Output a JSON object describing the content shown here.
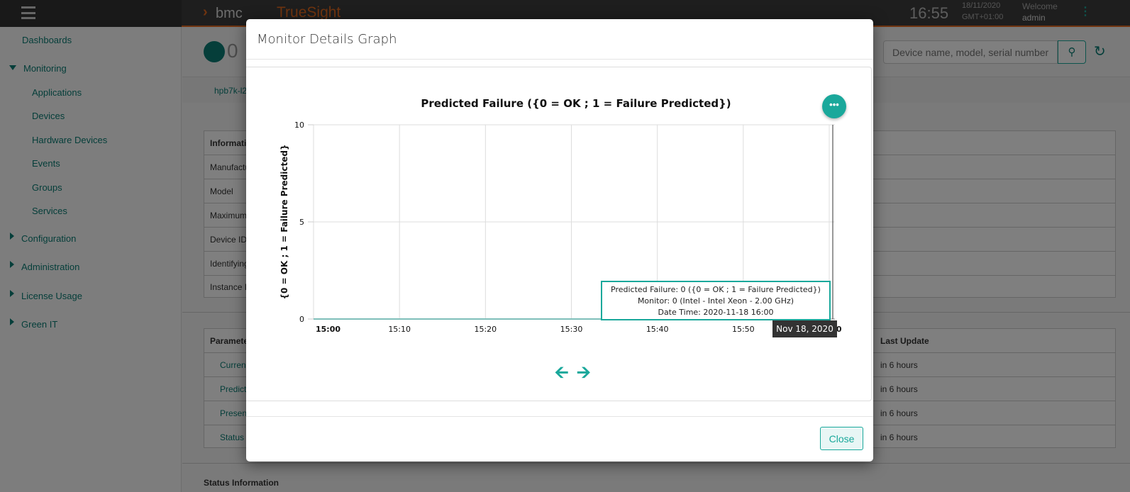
{
  "topbar": {
    "brand": "bmc",
    "product": "TrueSight",
    "time": "16:55",
    "date": "18/11/2020",
    "timezone": "GMT+01:00",
    "welcome": "Welcome",
    "user": "admin",
    "accent": "#e0681f"
  },
  "sidebar": {
    "items": [
      {
        "label": "Dashboards"
      },
      {
        "label": "Monitoring",
        "expanded": true,
        "children": [
          "Applications",
          "Devices",
          "Hardware Devices",
          "Events",
          "Groups",
          "Services"
        ]
      },
      {
        "label": "Configuration"
      },
      {
        "label": "Administration"
      },
      {
        "label": "License Usage"
      },
      {
        "label": "Green IT"
      }
    ]
  },
  "page": {
    "count": "0",
    "tab": "hpb7k-l2",
    "search_placeholder": "Device name, model, serial number",
    "info_table": {
      "header": "Informati",
      "rows": [
        "Manufactu",
        "Model",
        "Maximum",
        "Device ID",
        "Identifying",
        "Instance I"
      ]
    },
    "param_table": {
      "header": "Paramete",
      "last_update_header": "Last Update",
      "rows": [
        {
          "name": "Curren",
          "last_update": "in 6 hours"
        },
        {
          "name": "Predict",
          "last_update": "in 6 hours"
        },
        {
          "name": "Presen",
          "last_update": "in 6 hours"
        },
        {
          "name": "Status",
          "last_update": "in 6 hours"
        }
      ]
    },
    "status_heading": "Status Information"
  },
  "modal": {
    "title": "Monitor Details Graph",
    "close_label": "Close"
  },
  "chart_data": {
    "type": "line",
    "title": "Predicted Failure ({0 = OK ; 1 = Failure Predicted})",
    "ylabel": "{0 = OK ; 1 = Failure Predicted}",
    "xlabel": "",
    "ylim": [
      0,
      10
    ],
    "yticks": [
      "0",
      "5",
      "10"
    ],
    "xticks": [
      "15:00",
      "15:10",
      "15:20",
      "15:30",
      "15:40",
      "15:50",
      "16:00"
    ],
    "xlim": [
      "15:00",
      "16:00"
    ],
    "grid": true,
    "series": [
      {
        "x": [
          "15:00",
          "16:00"
        ],
        "values": [
          0,
          0
        ],
        "color": "#7fbfba"
      }
    ],
    "tooltip": {
      "line1": "Predicted Failure: 0 ({0 = OK ; 1 = Failure Predicted})",
      "line2": "Monitor: 0 (Intel - Intel Xeon - 2.00 GHz)",
      "line3": "Date Time: 2020-11-18 16:00"
    },
    "crosshair_label": "Nov 18, 2020",
    "crosshair_x": "16:00"
  },
  "colors": {
    "teal": "#1aa89b"
  }
}
